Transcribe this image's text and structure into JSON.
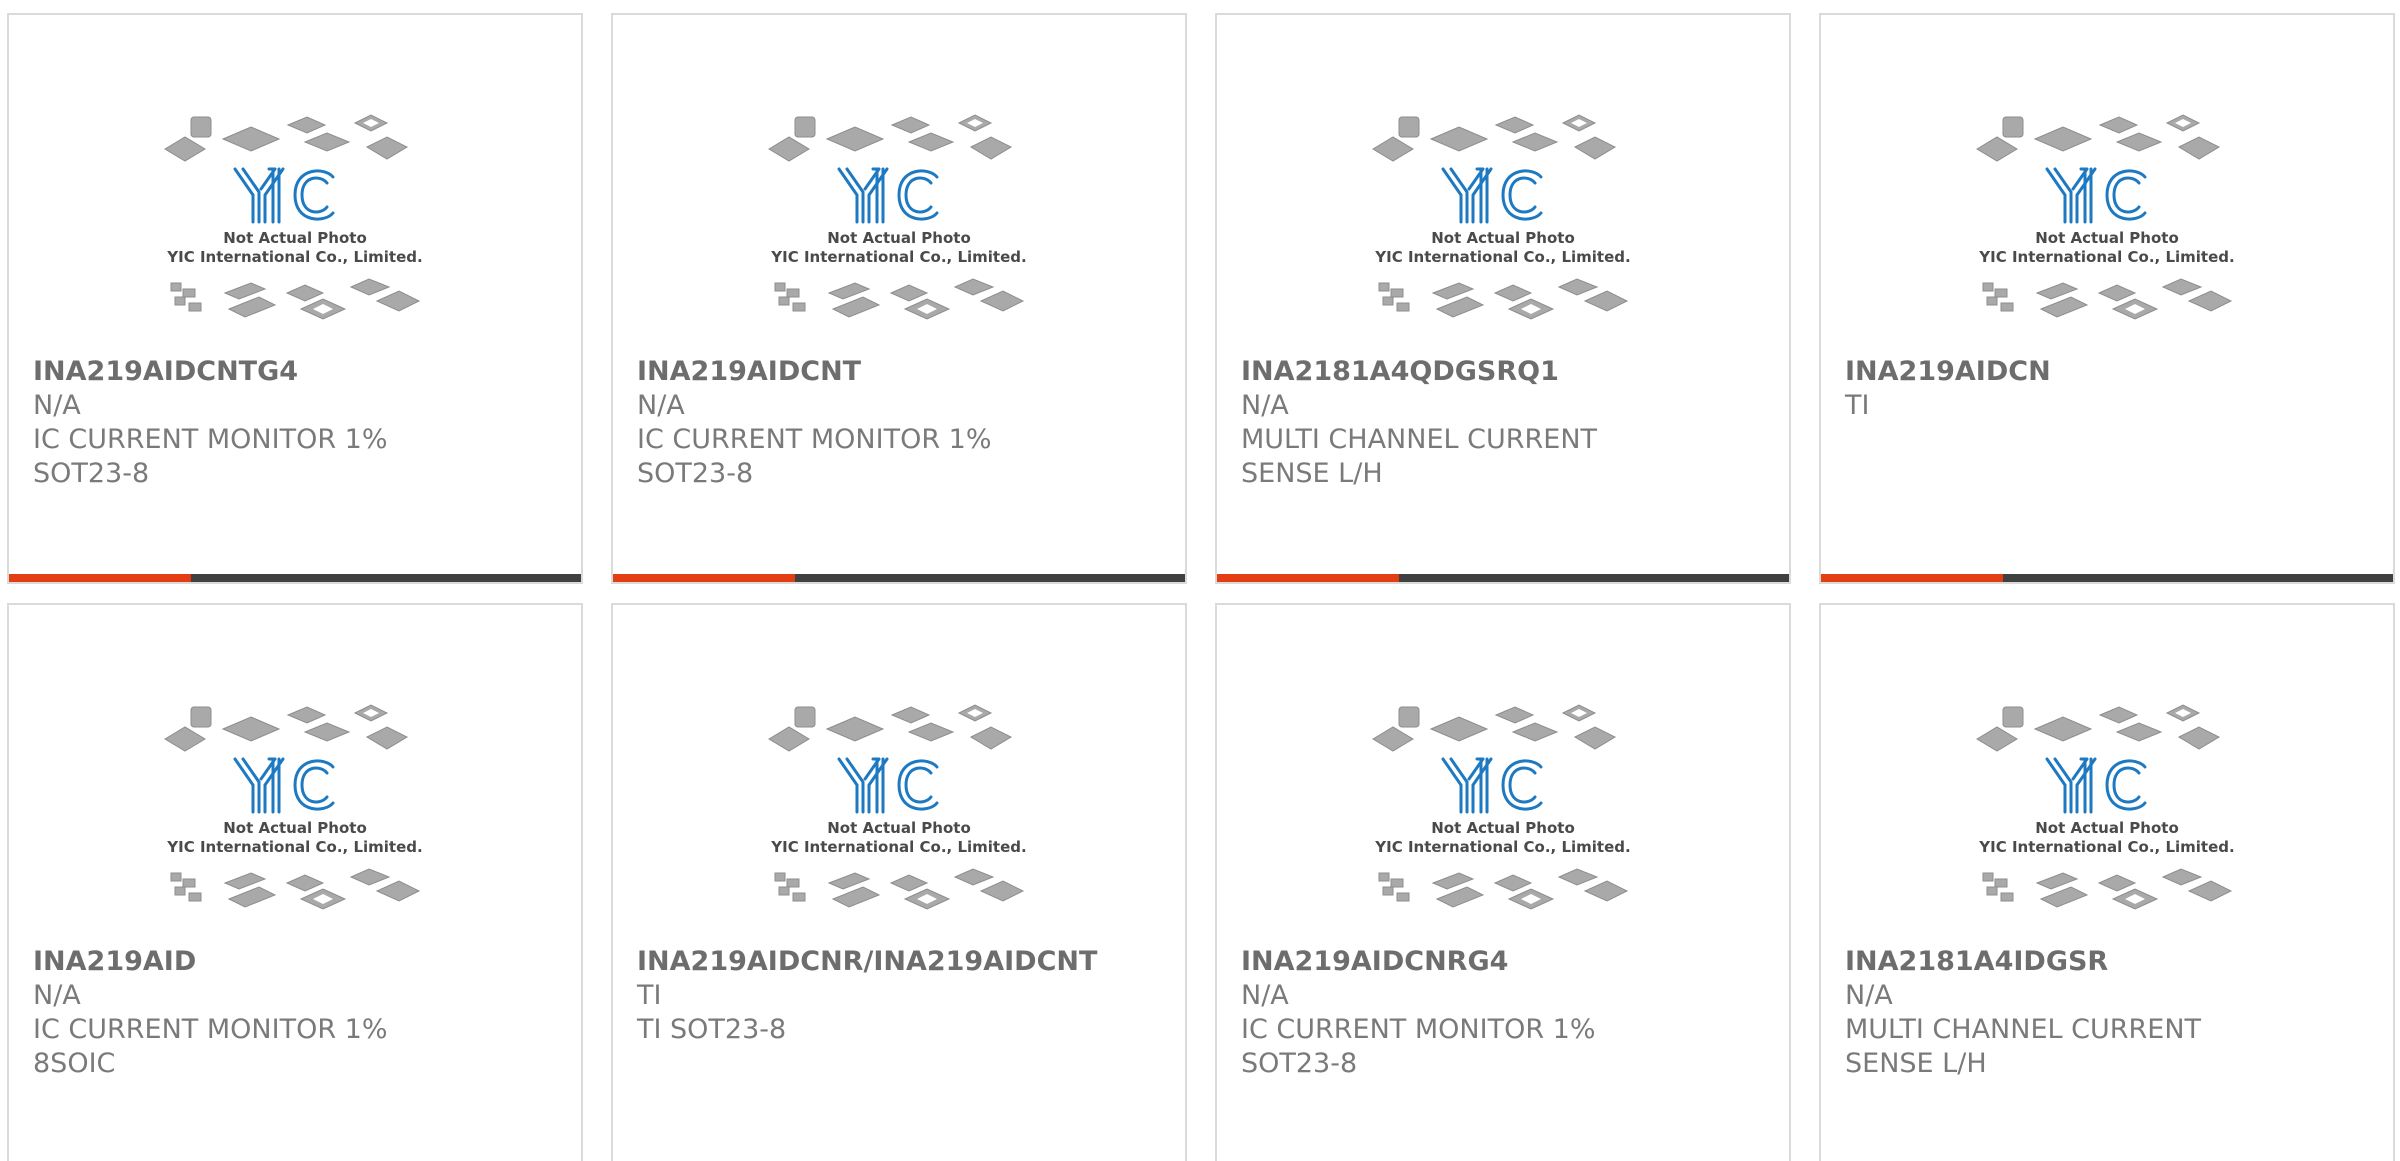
{
  "placeholder": {
    "line1": "Not Actual Photo",
    "line2": "YIC International Co., Limited.",
    "logo": "YIC"
  },
  "colors": {
    "accent": "#e23d13",
    "bar": "#404040",
    "logo_blue": "#1d7ac2"
  },
  "products": [
    {
      "part": "INA219AIDCNTG4",
      "mfr": "N/A",
      "desc1": "IC CURRENT MONITOR 1%",
      "desc2": "SOT23-8"
    },
    {
      "part": "INA219AIDCNT",
      "mfr": "N/A",
      "desc1": "IC CURRENT MONITOR 1%",
      "desc2": "SOT23-8"
    },
    {
      "part": "INA2181A4QDGSRQ1",
      "mfr": "N/A",
      "desc1": "MULTI CHANNEL CURRENT",
      "desc2": "SENSE L/H"
    },
    {
      "part": "INA219AIDCN",
      "mfr": "TI",
      "desc1": "",
      "desc2": ""
    },
    {
      "part": "INA219AID",
      "mfr": "N/A",
      "desc1": "IC CURRENT MONITOR 1%",
      "desc2": "8SOIC"
    },
    {
      "part": "INA219AIDCNR/INA219AIDCNT",
      "mfr": "TI",
      "desc1": "TI SOT23-8",
      "desc2": ""
    },
    {
      "part": "INA219AIDCNRG4",
      "mfr": "N/A",
      "desc1": "IC CURRENT MONITOR 1%",
      "desc2": "SOT23-8"
    },
    {
      "part": "INA2181A4IDGSR",
      "mfr": "N/A",
      "desc1": "MULTI CHANNEL CURRENT",
      "desc2": "SENSE L/H"
    }
  ]
}
